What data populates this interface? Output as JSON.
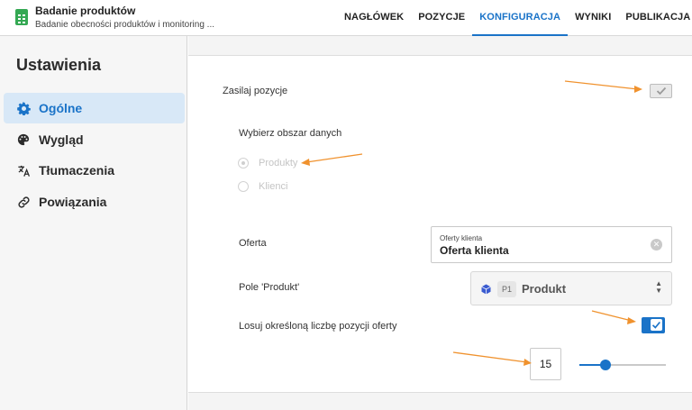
{
  "header": {
    "title": "Badanie produktów",
    "subtitle": "Badanie obecności produktów i monitoring ...",
    "tabs": [
      {
        "label": "NAGŁÓWEK"
      },
      {
        "label": "POZYCJE"
      },
      {
        "label": "KONFIGURACJA"
      },
      {
        "label": "WYNIKI"
      },
      {
        "label": "PUBLIKACJA"
      }
    ],
    "active_tab": "KONFIGURACJA"
  },
  "sidebar": {
    "title": "Ustawienia",
    "items": [
      {
        "label": "Ogólne",
        "icon": "gear-icon"
      },
      {
        "label": "Wygląd",
        "icon": "palette-icon"
      },
      {
        "label": "Tłumaczenia",
        "icon": "translate-icon"
      },
      {
        "label": "Powiązania",
        "icon": "link-icon"
      }
    ],
    "active_item": "Ogólne"
  },
  "form": {
    "feed_items_label": "Zasilaj pozycje",
    "feed_items_checked": true,
    "data_area_label": "Wybierz obszar danych",
    "data_area_options": [
      "Produkty",
      "Klienci"
    ],
    "data_area_selected": "Produkty",
    "offer_label": "Oferta",
    "offer_field_label": "Oferty klienta",
    "offer_field_value": "Oferta klienta",
    "product_field_label": "Pole 'Produkt'",
    "product_badge": "P1",
    "product_value": "Produkt",
    "random_label": "Losuj określoną liczbę pozycji oferty",
    "random_checked": true,
    "count_value": "15",
    "slider_level": 0.3
  },
  "colors": {
    "accent": "#1a73c8",
    "arrow": "#f0922e",
    "sidebar_active_bg": "#d8e8f7"
  }
}
